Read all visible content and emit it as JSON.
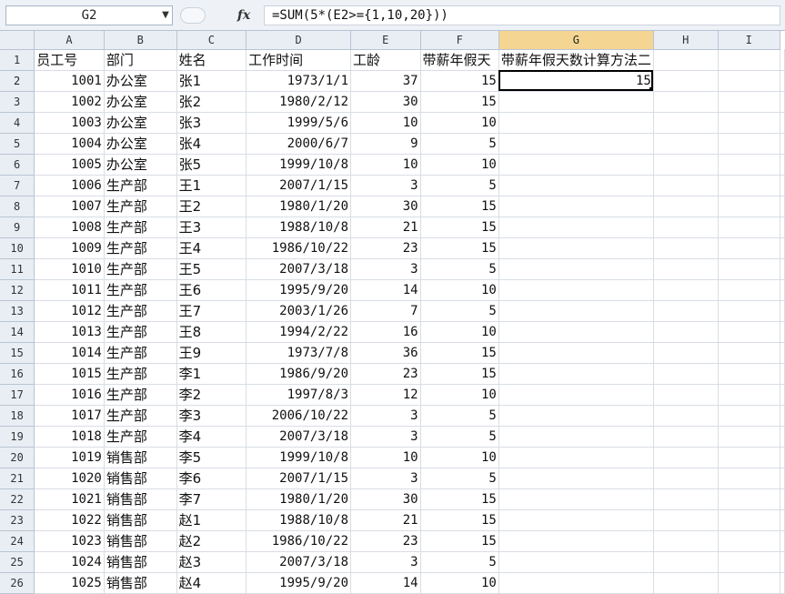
{
  "formula_bar": {
    "name_box": "G2",
    "fx_label": "fx",
    "formula": "=SUM(5*(E2>={1,10,20}))"
  },
  "columns": [
    "A",
    "B",
    "C",
    "D",
    "E",
    "F",
    "G",
    "H",
    "I"
  ],
  "active_column": "G",
  "header_row": {
    "row_num": "1",
    "cells": [
      "员工号",
      "部门",
      "姓名",
      "工作时间",
      "工龄",
      "带薪年假天",
      "带薪年假天数计算方法二",
      "",
      ""
    ]
  },
  "rows": [
    {
      "n": "2",
      "id": "1001",
      "dept": "办公室",
      "name": "张1",
      "date": "1973/1/1",
      "years": "37",
      "days": "15",
      "g": "15"
    },
    {
      "n": "3",
      "id": "1002",
      "dept": "办公室",
      "name": "张2",
      "date": "1980/2/12",
      "years": "30",
      "days": "15",
      "g": ""
    },
    {
      "n": "4",
      "id": "1003",
      "dept": "办公室",
      "name": "张3",
      "date": "1999/5/6",
      "years": "10",
      "days": "10",
      "g": ""
    },
    {
      "n": "5",
      "id": "1004",
      "dept": "办公室",
      "name": "张4",
      "date": "2000/6/7",
      "years": "9",
      "days": "5",
      "g": ""
    },
    {
      "n": "6",
      "id": "1005",
      "dept": "办公室",
      "name": "张5",
      "date": "1999/10/8",
      "years": "10",
      "days": "10",
      "g": ""
    },
    {
      "n": "7",
      "id": "1006",
      "dept": "生产部",
      "name": "王1",
      "date": "2007/1/15",
      "years": "3",
      "days": "5",
      "g": ""
    },
    {
      "n": "8",
      "id": "1007",
      "dept": "生产部",
      "name": "王2",
      "date": "1980/1/20",
      "years": "30",
      "days": "15",
      "g": ""
    },
    {
      "n": "9",
      "id": "1008",
      "dept": "生产部",
      "name": "王3",
      "date": "1988/10/8",
      "years": "21",
      "days": "15",
      "g": ""
    },
    {
      "n": "10",
      "id": "1009",
      "dept": "生产部",
      "name": "王4",
      "date": "1986/10/22",
      "years": "23",
      "days": "15",
      "g": ""
    },
    {
      "n": "11",
      "id": "1010",
      "dept": "生产部",
      "name": "王5",
      "date": "2007/3/18",
      "years": "3",
      "days": "5",
      "g": ""
    },
    {
      "n": "12",
      "id": "1011",
      "dept": "生产部",
      "name": "王6",
      "date": "1995/9/20",
      "years": "14",
      "days": "10",
      "g": ""
    },
    {
      "n": "13",
      "id": "1012",
      "dept": "生产部",
      "name": "王7",
      "date": "2003/1/26",
      "years": "7",
      "days": "5",
      "g": ""
    },
    {
      "n": "14",
      "id": "1013",
      "dept": "生产部",
      "name": "王8",
      "date": "1994/2/22",
      "years": "16",
      "days": "10",
      "g": ""
    },
    {
      "n": "15",
      "id": "1014",
      "dept": "生产部",
      "name": "王9",
      "date": "1973/7/8",
      "years": "36",
      "days": "15",
      "g": ""
    },
    {
      "n": "16",
      "id": "1015",
      "dept": "生产部",
      "name": "李1",
      "date": "1986/9/20",
      "years": "23",
      "days": "15",
      "g": ""
    },
    {
      "n": "17",
      "id": "1016",
      "dept": "生产部",
      "name": "李2",
      "date": "1997/8/3",
      "years": "12",
      "days": "10",
      "g": ""
    },
    {
      "n": "18",
      "id": "1017",
      "dept": "生产部",
      "name": "李3",
      "date": "2006/10/22",
      "years": "3",
      "days": "5",
      "g": ""
    },
    {
      "n": "19",
      "id": "1018",
      "dept": "生产部",
      "name": "李4",
      "date": "2007/3/18",
      "years": "3",
      "days": "5",
      "g": ""
    },
    {
      "n": "20",
      "id": "1019",
      "dept": "销售部",
      "name": "李5",
      "date": "1999/10/8",
      "years": "10",
      "days": "10",
      "g": ""
    },
    {
      "n": "21",
      "id": "1020",
      "dept": "销售部",
      "name": "李6",
      "date": "2007/1/15",
      "years": "3",
      "days": "5",
      "g": ""
    },
    {
      "n": "22",
      "id": "1021",
      "dept": "销售部",
      "name": "李7",
      "date": "1980/1/20",
      "years": "30",
      "days": "15",
      "g": ""
    },
    {
      "n": "23",
      "id": "1022",
      "dept": "销售部",
      "name": "赵1",
      "date": "1988/10/8",
      "years": "21",
      "days": "15",
      "g": ""
    },
    {
      "n": "24",
      "id": "1023",
      "dept": "销售部",
      "name": "赵2",
      "date": "1986/10/22",
      "years": "23",
      "days": "15",
      "g": ""
    },
    {
      "n": "25",
      "id": "1024",
      "dept": "销售部",
      "name": "赵3",
      "date": "2007/3/18",
      "years": "3",
      "days": "5",
      "g": ""
    },
    {
      "n": "26",
      "id": "1025",
      "dept": "销售部",
      "name": "赵4",
      "date": "1995/9/20",
      "years": "14",
      "days": "10",
      "g": ""
    }
  ]
}
